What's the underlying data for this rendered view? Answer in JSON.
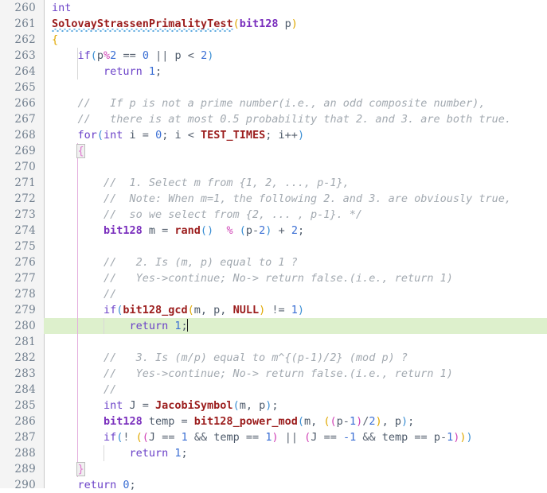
{
  "editor": {
    "name": "code-editor",
    "language": "C++",
    "first_line": 260,
    "last_line": 290,
    "current_line": 280,
    "colors": {
      "background": "#ffffff",
      "gutter_background": "#f4f4f4",
      "gutter_text": "#72808f",
      "current_line_highlight": "#ddf0cc",
      "comment": "#a2a9b0",
      "keyword": "#6a40c8",
      "type": "#7a2fbd",
      "function": "#9b1c1c",
      "number": "#3b6fd4",
      "operator": "#d043b6",
      "paren_depth0": "#3b8fd4",
      "paren_depth1": "#e0a800",
      "paren_depth2": "#d043b6",
      "indent_guide": "#d8d8d8",
      "indent_guide_active": "#e4aedd",
      "squiggle_underline": "#5aa8e0"
    }
  },
  "lines": [
    {
      "n": "260",
      "text": "int"
    },
    {
      "n": "261",
      "text": "SolovayStrassenPrimalityTest(bit128 p)"
    },
    {
      "n": "262",
      "text": "{"
    },
    {
      "n": "263",
      "text": "    if(p%2 == 0 || p < 2)"
    },
    {
      "n": "264",
      "text": "        return 1;"
    },
    {
      "n": "265",
      "text": ""
    },
    {
      "n": "266",
      "text": "    //   If p is not a prime number(i.e., an odd composite number),"
    },
    {
      "n": "267",
      "text": "    //   there is at most 0.5 probability that 2. and 3. are both true."
    },
    {
      "n": "268",
      "text": "    for(int i = 0; i < TEST_TIMES; i++)"
    },
    {
      "n": "269",
      "text": "    {"
    },
    {
      "n": "270",
      "text": ""
    },
    {
      "n": "271",
      "text": "        //  1. Select m from {1, 2, ..., p-1},"
    },
    {
      "n": "272",
      "text": "        //  Note: When m=1, the following 2. and 3. are obviously true,"
    },
    {
      "n": "273",
      "text": "        //  so we select from {2, ... , p-1}. */"
    },
    {
      "n": "274",
      "text": "        bit128 m = rand()  % (p-2) + 2;"
    },
    {
      "n": "275",
      "text": ""
    },
    {
      "n": "276",
      "text": "        //   2. Is (m, p) equal to 1 ?"
    },
    {
      "n": "277",
      "text": "        //   Yes->continue; No-> return false.(i.e., return 1)"
    },
    {
      "n": "278",
      "text": "        //"
    },
    {
      "n": "279",
      "text": "        if(bit128_gcd(m, p, NULL) != 1)"
    },
    {
      "n": "280",
      "text": "            return 1;"
    },
    {
      "n": "281",
      "text": ""
    },
    {
      "n": "282",
      "text": "        //   3. Is (m/p) equal to m^{(p-1)/2} (mod p) ?"
    },
    {
      "n": "283",
      "text": "        //   Yes->continue; No-> return false.(i.e., return 1)"
    },
    {
      "n": "284",
      "text": "        //"
    },
    {
      "n": "285",
      "text": "        int J = JacobiSymbol(m, p);"
    },
    {
      "n": "286",
      "text": "        bit128 temp = bit128_power_mod(m, ((p-1)/2), p);"
    },
    {
      "n": "287",
      "text": "        if(! ((J == 1 && temp == 1) || (J == -1 && temp == p-1)))"
    },
    {
      "n": "288",
      "text": "            return 1;"
    },
    {
      "n": "289",
      "text": "    }"
    },
    {
      "n": "290",
      "text": "    return 0;"
    }
  ],
  "tokens": {
    "l260": [
      {
        "t": "int",
        "c": "kw"
      }
    ],
    "l261": [
      {
        "t": "SolovayStrassenPrimalityTest",
        "c": "fn"
      },
      {
        "t": "(",
        "c": "p1"
      },
      {
        "t": "bit128",
        "c": "type"
      },
      {
        "t": " p",
        "c": "plain"
      },
      {
        "t": ")",
        "c": "p1"
      }
    ],
    "l262": [
      {
        "t": "{",
        "c": "brace"
      }
    ],
    "l263": [
      {
        "t": "if",
        "c": "kw"
      },
      {
        "t": "(",
        "c": "p0"
      },
      {
        "t": "p",
        "c": "plain"
      },
      {
        "t": "%",
        "c": "op"
      },
      {
        "t": "2",
        "c": "num"
      },
      {
        "t": " ",
        "c": "plain"
      },
      {
        "t": "==",
        "c": "op2"
      },
      {
        "t": " ",
        "c": "plain"
      },
      {
        "t": "0",
        "c": "num"
      },
      {
        "t": " ",
        "c": "plain"
      },
      {
        "t": "||",
        "c": "op2"
      },
      {
        "t": " p ",
        "c": "plain"
      },
      {
        "t": "<",
        "c": "op2"
      },
      {
        "t": " ",
        "c": "plain"
      },
      {
        "t": "2",
        "c": "num"
      },
      {
        "t": ")",
        "c": "p0"
      }
    ],
    "l264": [
      {
        "t": "return",
        "c": "kw"
      },
      {
        "t": " ",
        "c": "plain"
      },
      {
        "t": "1",
        "c": "num"
      },
      {
        "t": ";",
        "c": "plain"
      }
    ],
    "l268": [
      {
        "t": "for",
        "c": "kw"
      },
      {
        "t": "(",
        "c": "p0"
      },
      {
        "t": "int",
        "c": "kw"
      },
      {
        "t": " i ",
        "c": "plain"
      },
      {
        "t": "=",
        "c": "op2"
      },
      {
        "t": " ",
        "c": "plain"
      },
      {
        "t": "0",
        "c": "num"
      },
      {
        "t": "; i ",
        "c": "plain"
      },
      {
        "t": "<",
        "c": "op2"
      },
      {
        "t": " ",
        "c": "plain"
      },
      {
        "t": "TEST_TIMES",
        "c": "fn"
      },
      {
        "t": "; i",
        "c": "plain"
      },
      {
        "t": "++",
        "c": "op2"
      },
      {
        "t": ")",
        "c": "p0"
      }
    ],
    "l274": [
      {
        "t": "bit128",
        "c": "type"
      },
      {
        "t": " m ",
        "c": "plain"
      },
      {
        "t": "=",
        "c": "op2"
      },
      {
        "t": " ",
        "c": "plain"
      },
      {
        "t": "rand",
        "c": "fn"
      },
      {
        "t": "()",
        "c": "p0"
      },
      {
        "t": "  ",
        "c": "plain"
      },
      {
        "t": "%",
        "c": "op"
      },
      {
        "t": " ",
        "c": "plain"
      },
      {
        "t": "(",
        "c": "p0"
      },
      {
        "t": "p",
        "c": "plain"
      },
      {
        "t": "-",
        "c": "op2"
      },
      {
        "t": "2",
        "c": "num"
      },
      {
        "t": ")",
        "c": "p0"
      },
      {
        "t": " ",
        "c": "plain"
      },
      {
        "t": "+",
        "c": "op2"
      },
      {
        "t": " ",
        "c": "plain"
      },
      {
        "t": "2",
        "c": "num"
      },
      {
        "t": ";",
        "c": "plain"
      }
    ],
    "l279": [
      {
        "t": "if",
        "c": "kw"
      },
      {
        "t": "(",
        "c": "p0"
      },
      {
        "t": "bit128_gcd",
        "c": "fn"
      },
      {
        "t": "(",
        "c": "p1"
      },
      {
        "t": "m, p, ",
        "c": "plain"
      },
      {
        "t": "NULL",
        "c": "fn"
      },
      {
        "t": ")",
        "c": "p1"
      },
      {
        "t": " ",
        "c": "plain"
      },
      {
        "t": "!=",
        "c": "op2"
      },
      {
        "t": " ",
        "c": "plain"
      },
      {
        "t": "1",
        "c": "num"
      },
      {
        "t": ")",
        "c": "p0"
      }
    ],
    "l280": [
      {
        "t": "return",
        "c": "kw"
      },
      {
        "t": " ",
        "c": "plain"
      },
      {
        "t": "1",
        "c": "num"
      },
      {
        "t": ";",
        "c": "plain"
      }
    ],
    "l285": [
      {
        "t": "int",
        "c": "kw"
      },
      {
        "t": " J ",
        "c": "plain"
      },
      {
        "t": "=",
        "c": "op2"
      },
      {
        "t": " ",
        "c": "plain"
      },
      {
        "t": "JacobiSymbol",
        "c": "fn"
      },
      {
        "t": "(",
        "c": "p0"
      },
      {
        "t": "m, p",
        "c": "plain"
      },
      {
        "t": ")",
        "c": "p0"
      },
      {
        "t": ";",
        "c": "plain"
      }
    ],
    "l286": [
      {
        "t": "bit128",
        "c": "type"
      },
      {
        "t": " temp ",
        "c": "plain"
      },
      {
        "t": "=",
        "c": "op2"
      },
      {
        "t": " ",
        "c": "plain"
      },
      {
        "t": "bit128_power_mod",
        "c": "fn"
      },
      {
        "t": "(",
        "c": "p0"
      },
      {
        "t": "m, ",
        "c": "plain"
      },
      {
        "t": "(",
        "c": "p1"
      },
      {
        "t": "(",
        "c": "p2"
      },
      {
        "t": "p",
        "c": "plain"
      },
      {
        "t": "-",
        "c": "op2"
      },
      {
        "t": "1",
        "c": "num"
      },
      {
        "t": ")",
        "c": "p2"
      },
      {
        "t": "/",
        "c": "op2"
      },
      {
        "t": "2",
        "c": "num"
      },
      {
        "t": ")",
        "c": "p1"
      },
      {
        "t": ", p",
        "c": "plain"
      },
      {
        "t": ")",
        "c": "p0"
      },
      {
        "t": ";",
        "c": "plain"
      }
    ],
    "l287": [
      {
        "t": "if",
        "c": "kw"
      },
      {
        "t": "(",
        "c": "p0"
      },
      {
        "t": "!",
        "c": "op2"
      },
      {
        "t": " ",
        "c": "plain"
      },
      {
        "t": "(",
        "c": "p1"
      },
      {
        "t": "(",
        "c": "p2"
      },
      {
        "t": "J ",
        "c": "plain"
      },
      {
        "t": "==",
        "c": "op2"
      },
      {
        "t": " ",
        "c": "plain"
      },
      {
        "t": "1",
        "c": "num"
      },
      {
        "t": " ",
        "c": "plain"
      },
      {
        "t": "&&",
        "c": "op2"
      },
      {
        "t": " temp ",
        "c": "plain"
      },
      {
        "t": "==",
        "c": "op2"
      },
      {
        "t": " ",
        "c": "plain"
      },
      {
        "t": "1",
        "c": "num"
      },
      {
        "t": ")",
        "c": "p2"
      },
      {
        "t": " ",
        "c": "plain"
      },
      {
        "t": "||",
        "c": "op2"
      },
      {
        "t": " ",
        "c": "plain"
      },
      {
        "t": "(",
        "c": "p2"
      },
      {
        "t": "J ",
        "c": "plain"
      },
      {
        "t": "==",
        "c": "op2"
      },
      {
        "t": " ",
        "c": "plain"
      },
      {
        "t": "-1",
        "c": "num"
      },
      {
        "t": " ",
        "c": "plain"
      },
      {
        "t": "&&",
        "c": "op2"
      },
      {
        "t": " temp ",
        "c": "plain"
      },
      {
        "t": "==",
        "c": "op2"
      },
      {
        "t": " p",
        "c": "plain"
      },
      {
        "t": "-",
        "c": "op2"
      },
      {
        "t": "1",
        "c": "num"
      },
      {
        "t": ")",
        "c": "p2"
      },
      {
        "t": ")",
        "c": "p1"
      },
      {
        "t": ")",
        "c": "p0"
      }
    ],
    "l288": [
      {
        "t": "return",
        "c": "kw"
      },
      {
        "t": " ",
        "c": "plain"
      },
      {
        "t": "1",
        "c": "num"
      },
      {
        "t": ";",
        "c": "plain"
      }
    ],
    "l290": [
      {
        "t": "return",
        "c": "kw"
      },
      {
        "t": " ",
        "c": "plain"
      },
      {
        "t": "0",
        "c": "num"
      },
      {
        "t": ";",
        "c": "plain"
      }
    ]
  },
  "comments": {
    "l266": "//   If p is not a prime number(i.e., an odd composite number),",
    "l267": "//   there is at most 0.5 probability that 2. and 3. are both true.",
    "l271": "//  1. Select m from {1, 2, ..., p-1},",
    "l272": "//  Note: When m=1, the following 2. and 3. are obviously true,",
    "l273": "//  so we select from {2, ... , p-1}. */",
    "l276": "//   2. Is (m, p) equal to 1 ?",
    "l277": "//   Yes->continue; No-> return false.(i.e., return 1)",
    "l278": "//",
    "l282": "//   3. Is (m/p) equal to m^{(p-1)/2} (mod p) ?",
    "l283": "//   Yes->continue; No-> return false.(i.e., return 1)",
    "l284": "//"
  },
  "braces": {
    "open_269": "{",
    "close_289": "}"
  },
  "linenos": [
    "260",
    "261",
    "262",
    "263",
    "264",
    "265",
    "266",
    "267",
    "268",
    "269",
    "270",
    "271",
    "272",
    "273",
    "274",
    "275",
    "276",
    "277",
    "278",
    "279",
    "280",
    "281",
    "282",
    "283",
    "284",
    "285",
    "286",
    "287",
    "288",
    "289",
    "290"
  ]
}
